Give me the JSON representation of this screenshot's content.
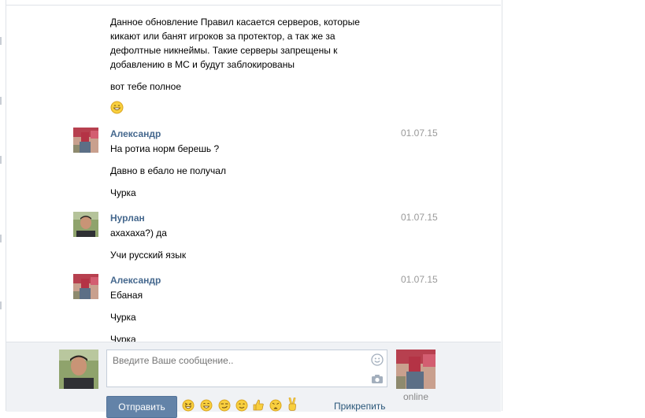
{
  "messages": {
    "continued_text": "Данное обновление Правил касается серверов, которые кикают или банят игроков за протектор, а так же за дефолтные никнеймы. Такие серверы запрещены к добавлению в МС и будут заблокированы",
    "continued_line1": "Данное обновление Правил касается серверов, которые",
    "continued_line2": "кикают или банят игроков за протектор, а так же за",
    "continued_line3": "дефолтные никнеймы. Такие серверы запрещены к",
    "continued_line4": "добавлению в МС и будут заблокированы",
    "continued_line5": "вот тебе полное",
    "continued_emoji": "grinning-emoji",
    "groups": [
      {
        "author": "Александр",
        "date": "01.07.15",
        "lines": [
          "На ротиа норм берешь ?",
          "Давно в ебало не получал",
          "Чурка"
        ]
      },
      {
        "author": "Нурлан",
        "date": "01.07.15",
        "lines": [
          "ахахаха?) да",
          "Учи русский язык"
        ]
      },
      {
        "author": "Александр",
        "date": "01.07.15",
        "lines": [
          "Ебаная",
          "Чурка",
          "Чурка"
        ]
      }
    ]
  },
  "composer": {
    "placeholder": "Введите Ваше сообщение..",
    "send_label": "Отправить",
    "attach_label": "Прикрепить",
    "recipient_status": "online",
    "emoji_icons": [
      "laughing-emoji",
      "grinning-emoji",
      "smirk-emoji",
      "blush-emoji",
      "thumbs-up-icon",
      "weary-emoji",
      "victory-hand-icon"
    ]
  },
  "colors": {
    "author_link": "#45688e",
    "send_button": "#6383a8",
    "composer_bg": "#f0f2f5",
    "date_gray": "#999999"
  }
}
